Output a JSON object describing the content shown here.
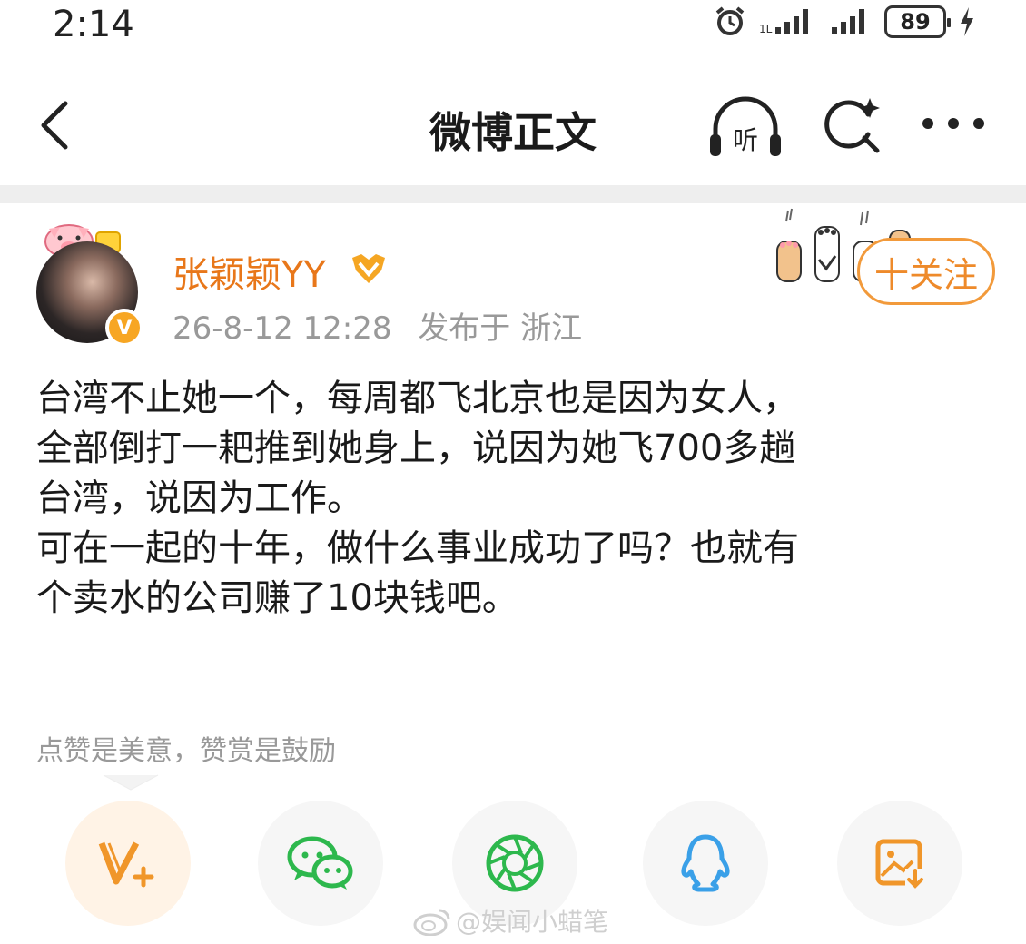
{
  "status_bar": {
    "time": "2:14",
    "battery": "89"
  },
  "nav": {
    "title": "微博正文",
    "listen_label": "听"
  },
  "post": {
    "username": "张颖颖YY",
    "timestamp": "26-8-12 12:28",
    "location": "发布于 浙江",
    "follow_label": "十关注",
    "verify_label": "V",
    "body_lines": [
      "台湾不止她一个，每周都飞北京也是因为女人，",
      "全部倒打一耙推到她身上，说因为她飞700多趟",
      "台湾，说因为工作。",
      "可在一起的十年，做什么事业成功了吗？也就有",
      "个卖水的公司赚了10块钱吧。"
    ]
  },
  "reward_tip": "点赞是美意，赞赏是鼓励",
  "share": {
    "items": [
      "v-plus",
      "wechat",
      "moments",
      "qq",
      "save-image"
    ]
  },
  "watermark": "@娱闻小蜡笔",
  "colors": {
    "accent_orange": "#ee8a2a",
    "username": "#e8771a",
    "meta_gray": "#999999",
    "wechat_green": "#2db84d",
    "qq_blue": "#3aa0e8"
  }
}
